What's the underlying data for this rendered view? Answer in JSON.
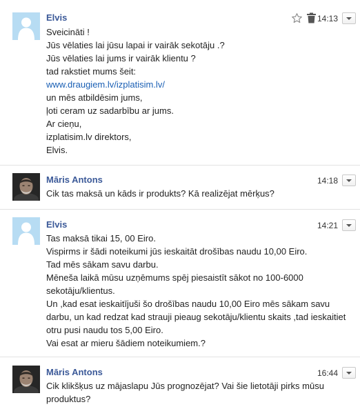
{
  "messages": [
    {
      "sender": "Elvis",
      "time": "14:13",
      "lines": [
        "Sveicināti !",
        "Jūs vēlaties lai jūsu lapai ir vairāk sekotāju .?",
        "Jūs vēlaties lai jums ir vairāk klientu ?",
        "tad rakstiet mums šeit:",
        "www.draugiem.lv/izplatisim.lv/",
        "un mēs atbildēsim jums,",
        "ļoti ceram uz sadarbību ar jums.",
        "Ar cieņu,",
        "izplatisim.lv direktors,",
        "Elvis."
      ]
    },
    {
      "sender": "Māris Antons",
      "time": "14:18",
      "lines": [
        "Cik tas maksā un kāds ir produkts? Kā realizējat mērķus?"
      ]
    },
    {
      "sender": "Elvis",
      "time": "14:21",
      "lines": [
        "Tas maksā tikai 15, 00 Eiro.",
        "Vispirms ir šādi noteikumi jūs ieskaitāt drošības naudu 10,00 Eiro.",
        "Tad mēs sākam savu darbu.",
        "Mēneša laikā mūsu uzņēmums spēj piesaistīt sākot no 100-6000 sekotāju/klientus.",
        "Un ,kad esat ieskaitījuši šo drošības naudu 10,00 Eiro mēs sākam savu darbu, un kad redzat kad strauji pieaug sekotāju/klientu skaits ,tad ieskaitiet otru pusi naudu tos 5,00 Eiro.",
        "Vai esat ar mieru šādiem noteikumiem.?"
      ]
    },
    {
      "sender": "Māris Antons",
      "time": "16:44",
      "lines": [
        "Cik klikšķus uz mājaslapu Jūs prognozējat? Vai šie lietotāji pirks mūsu produktus?"
      ]
    }
  ],
  "icons": {
    "star": "star-outline-icon",
    "trash": "trash-icon",
    "menu": "chevron-down-icon",
    "avatar_default": "default-avatar-icon",
    "avatar_photo": "user-photo-avatar"
  },
  "colors": {
    "sender": "#3b5998",
    "link": "#1a5fb4",
    "text": "#222222",
    "separator": "#e2e2e2"
  }
}
